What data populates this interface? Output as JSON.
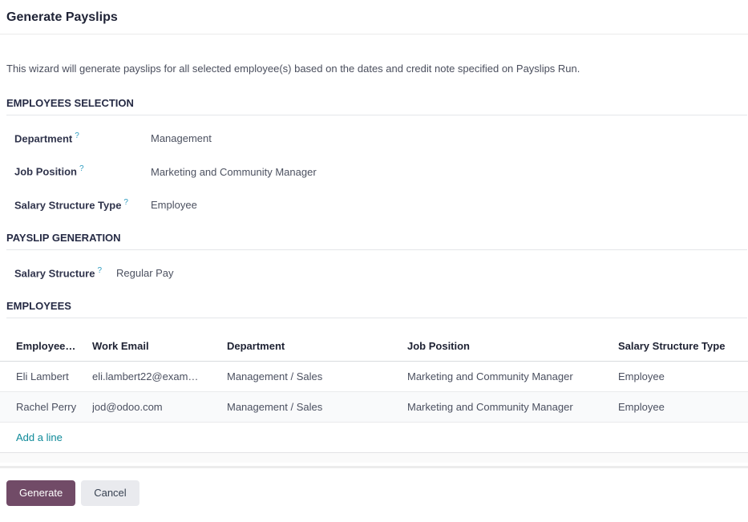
{
  "page": {
    "title": "Generate Payslips",
    "description": "This wizard will generate payslips for all selected employee(s) based on the dates and credit note specified on Payslips Run."
  },
  "help_marker": "?",
  "colors": {
    "primary_button": "#714B67",
    "link": "#0e8a99",
    "help_marker": "#2f9dc1",
    "heading_text": "#252a44"
  },
  "employees_selection": {
    "heading": "EMPLOYEES SELECTION",
    "fields": [
      {
        "label": "Department",
        "value": "Management"
      },
      {
        "label": "Job Position",
        "value": "Marketing and Community Manager"
      },
      {
        "label": "Salary Structure Type",
        "value": "Employee"
      }
    ]
  },
  "payslip_generation": {
    "heading": "PAYSLIP GENERATION",
    "fields": [
      {
        "label": "Salary Structure",
        "value": "Regular Pay"
      }
    ]
  },
  "employees_table": {
    "heading": "EMPLOYEES",
    "columns": [
      "Employee…",
      "Work Email",
      "Department",
      "Job Position",
      "Salary Structure Type"
    ],
    "rows": [
      [
        "Eli Lambert",
        "eli.lambert22@exam…",
        "Management / Sales",
        "Marketing and Community Manager",
        "Employee"
      ],
      [
        "Rachel Perry",
        "jod@odoo.com",
        "Management / Sales",
        "Marketing and Community Manager",
        "Employee"
      ]
    ],
    "add_line_label": "Add a line"
  },
  "footer": {
    "generate_label": "Generate",
    "cancel_label": "Cancel"
  }
}
